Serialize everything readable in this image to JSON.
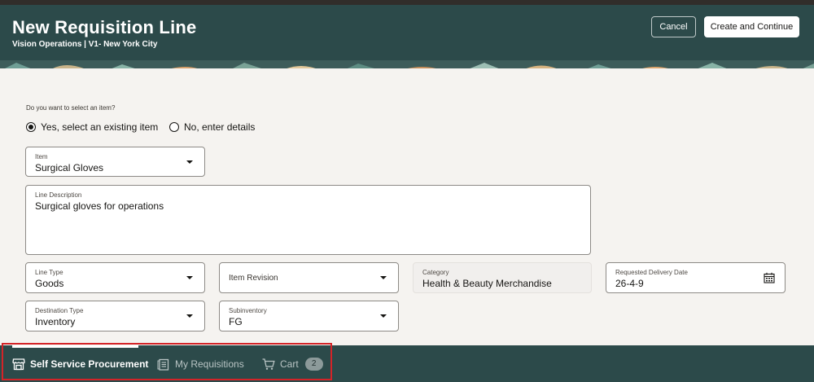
{
  "header": {
    "title": "New Requisition Line",
    "subtitle": "Vision Operations | V1- New York City",
    "cancel_label": "Cancel",
    "create_label": "Create and Continue"
  },
  "form": {
    "question": "Do you want to select an item?",
    "radio_yes": "Yes, select an existing item",
    "radio_no": "No, enter details",
    "item": {
      "label": "Item",
      "value": "Surgical Gloves"
    },
    "line_description": {
      "label": "Line Description",
      "value": "Surgical gloves for operations"
    },
    "line_type": {
      "label": "Line Type",
      "value": "Goods"
    },
    "item_revision": {
      "placeholder": "Item Revision"
    },
    "category": {
      "label": "Category",
      "value": "Health & Beauty Merchandise"
    },
    "requested_delivery_date": {
      "label": "Requested Delivery Date",
      "value": "26-4-9"
    },
    "destination_type": {
      "label": "Destination Type",
      "value": "Inventory"
    },
    "subinventory": {
      "label": "Subinventory",
      "value": "FG"
    }
  },
  "footer_nav": {
    "items": [
      {
        "label": "Self Service Procurement",
        "icon": "store-icon",
        "active": true
      },
      {
        "label": "My Requisitions",
        "icon": "clipboard-icon",
        "active": false
      },
      {
        "label": "Cart",
        "icon": "cart-icon",
        "active": false,
        "badge": "2"
      }
    ]
  },
  "colors": {
    "header_bg": "#2c4a4a",
    "page_bg": "#f5f3f0",
    "highlight": "#d42428"
  }
}
